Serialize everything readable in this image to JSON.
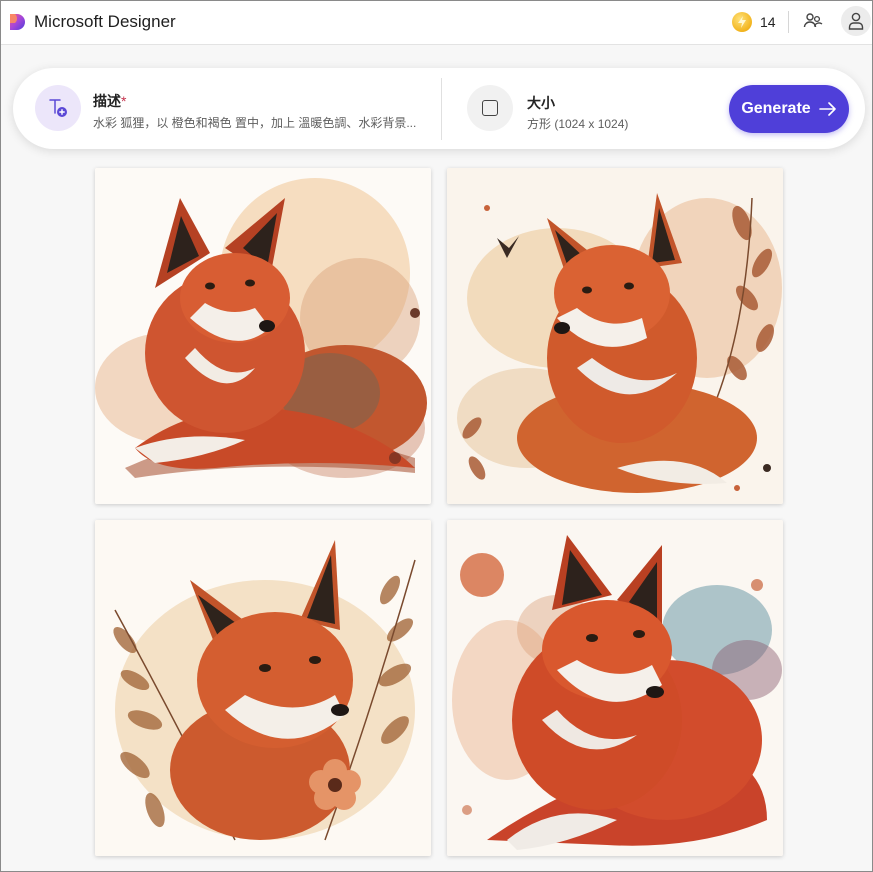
{
  "header": {
    "app_title": "Microsoft Designer",
    "credits": "14",
    "icons": {
      "logo": "designer-logo",
      "credits": "lightning-coin-icon",
      "share": "share-people-icon",
      "account": "person-icon"
    }
  },
  "prompt": {
    "description_label": "描述",
    "required_mark": "*",
    "description_text": "水彩 狐狸，以 橙色和褐色 置中，加上 溫暖色調、水彩背景...",
    "size_label": "大小",
    "size_value": "方形 (1024 x 1024)",
    "generate_label": "Generate"
  },
  "gallery": {
    "images": [
      {
        "subject": "watercolor-fox-curled",
        "accent": "#c9462a"
      },
      {
        "subject": "watercolor-fox-leaves",
        "accent": "#d4562c"
      },
      {
        "subject": "watercolor-fox-floral",
        "accent": "#c24a26"
      },
      {
        "subject": "watercolor-fox-curled-blue",
        "accent": "#c73a22"
      }
    ]
  },
  "colors": {
    "accent": "#4f3fd9",
    "fox_orange": "#d0502a",
    "fox_dark": "#2b1e18",
    "paper": "#fbf6f0"
  }
}
